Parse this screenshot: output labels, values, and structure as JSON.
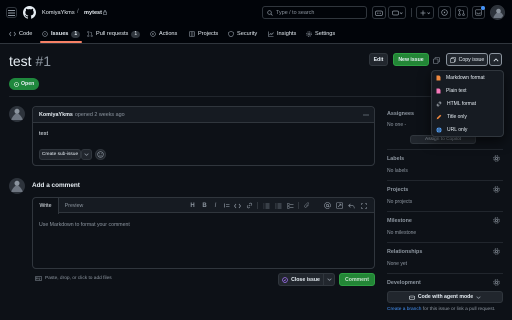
{
  "header": {
    "owner": "KomiyaYkms",
    "slash": "/",
    "repo": "mytest",
    "search_placeholder": "Type / to search"
  },
  "repo_nav": {
    "tabs": [
      {
        "label": "Code"
      },
      {
        "label": "Issues",
        "count": "1"
      },
      {
        "label": "Pull requests",
        "count": "1"
      },
      {
        "label": "Actions"
      },
      {
        "label": "Projects"
      },
      {
        "label": "Security"
      },
      {
        "label": "Insights"
      },
      {
        "label": "Settings"
      }
    ]
  },
  "issue": {
    "title": "test",
    "number": "#1",
    "status": "Open",
    "edit_label": "Edit",
    "new_issue_label": "New issue",
    "copy_issue_label": "Copy issue"
  },
  "copy_menu": {
    "items": [
      {
        "label": "Markdown format",
        "color": "#f0883e"
      },
      {
        "label": "Plain text",
        "color": "#f778ba"
      },
      {
        "label": "HTML format",
        "color": "#c9d1d9"
      },
      {
        "label": "Title only",
        "color": "#f0883e"
      },
      {
        "label": "URL only",
        "color": "#58a6ff"
      }
    ]
  },
  "comment": {
    "author": "KomiyaYkms",
    "meta": "opened 2 weeks ago",
    "body": "test",
    "sub_issue_label": "Create sub-issue"
  },
  "add_comment": {
    "heading": "Add a comment",
    "tab_write": "Write",
    "tab_preview": "Preview",
    "placeholder": "Use Markdown to format your comment",
    "attach_hint": "Paste, drop, or click to add files",
    "close_label": "Close issue",
    "comment_label": "Comment",
    "toolbar": {
      "heading": "H",
      "bold": "B",
      "italic": "I"
    }
  },
  "sidebar": {
    "assignees": {
      "label": "Assignees",
      "value": "No one -",
      "action": "Assign to Copilot"
    },
    "labels": {
      "label": "Labels",
      "value": "No labels"
    },
    "projects": {
      "label": "Projects",
      "value": "No projects"
    },
    "milestone": {
      "label": "Milestone",
      "value": "No milestone"
    },
    "relationships": {
      "label": "Relationships",
      "value": "None yet"
    },
    "development": {
      "label": "Development",
      "button": "Code with agent mode",
      "link_text": "Create a branch",
      "hint": "for this issue or link a pull request."
    }
  },
  "colors": {
    "accent_green": "#238636",
    "badge_green": "#1f883d",
    "tab_underline": "#f78166",
    "link": "#4493f8"
  }
}
